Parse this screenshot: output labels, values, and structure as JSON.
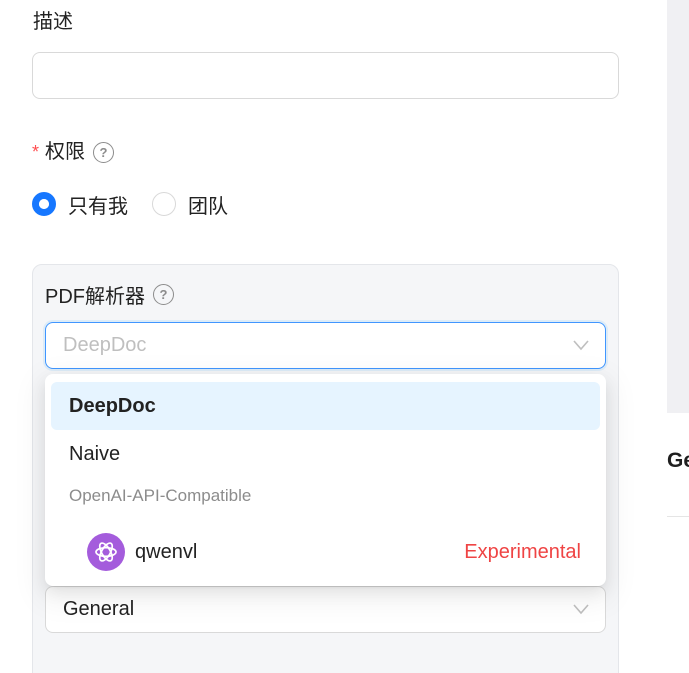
{
  "form": {
    "description_label": "描述",
    "description_value": "",
    "permission_label": "权限",
    "permission_required_mark": "*",
    "help_glyph": "?",
    "permission_options": [
      "只有我",
      "团队"
    ],
    "permission_selected": "只有我"
  },
  "parser": {
    "label": "PDF解析器",
    "placeholder": "DeepDoc",
    "options": [
      "DeepDoc",
      "Naive"
    ],
    "selected": "DeepDoc",
    "group_label": "OpenAI-API-Compatible",
    "group_option": "qwenvl",
    "group_option_tag": "Experimental",
    "group_option_icon": "openai-logo-icon"
  },
  "second_select": {
    "value": "General"
  },
  "right_panel": {
    "text": "Ge"
  },
  "colors": {
    "primary": "#1677ff",
    "selected_bg": "#e6f4ff",
    "experimental": "#ef4444",
    "logo_bg": "#a45cdc"
  }
}
